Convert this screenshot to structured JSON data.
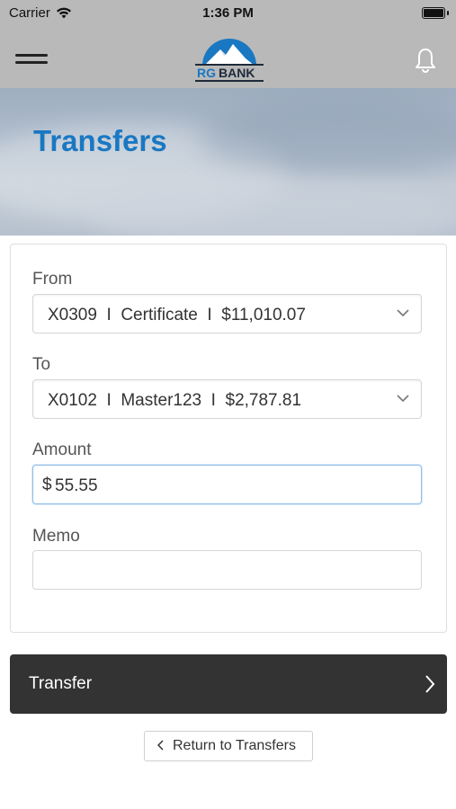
{
  "status_bar": {
    "carrier": "Carrier",
    "time": "1:36 PM"
  },
  "nav": {
    "logo_text": "RG BANK",
    "menu_icon": "hamburger-menu-icon",
    "notification_icon": "bell-icon"
  },
  "hero": {
    "title": "Transfers"
  },
  "form": {
    "from_label": "From",
    "from_value": "X0309  I  Certificate  I  $11,010.07",
    "to_label": "To",
    "to_value": "X0102  I  Master123  I  $2,787.81",
    "amount_label": "Amount",
    "amount_currency": "$",
    "amount_value": "55.55",
    "memo_label": "Memo",
    "memo_value": ""
  },
  "actions": {
    "transfer_label": "Transfer",
    "return_label": "Return to Transfers"
  },
  "colors": {
    "accent": "#1a78c2",
    "button_dark": "#333333",
    "nav_bg": "#b9b9b9"
  }
}
